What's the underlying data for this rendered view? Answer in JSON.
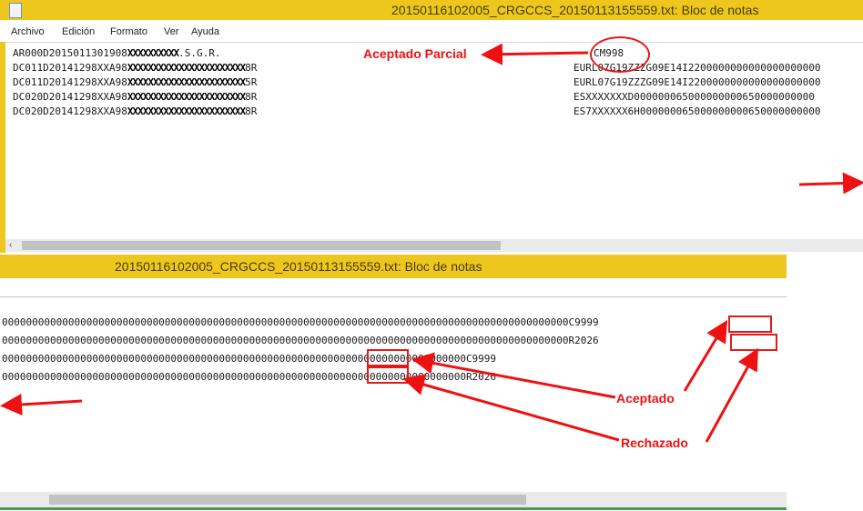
{
  "top_window": {
    "title": "20150116102005_CRGCCS_20150113155559.txt: Bloc de notas",
    "menu": [
      "Archivo",
      "Edición",
      "Formato",
      "Ver",
      "Ayuda"
    ],
    "lines": [
      {
        "prefix": "AR000D2015011301908",
        "redacted": "XXXXXXXXXX",
        "tail": ".S.G.R."
      },
      {
        "prefix": "DC011D20141298XXA98",
        "redacted": "XXXXXXXXXXXXXXXXXXXXXXX",
        "tail": "8R"
      },
      {
        "prefix": "DC011D20141298XXA98",
        "redacted": "XXXXXXXXXXXXXXXXXXXXXXX",
        "tail": "5R"
      },
      {
        "prefix": "DC020D20141298XXA98",
        "redacted": "XXXXXXXXXXXXXXXXXXXXXXX",
        "tail": "8R"
      },
      {
        "prefix": "DC020D20141298XXA98",
        "redacted": "XXXXXXXXXXXXXXXXXXXXXXX",
        "tail": "8R"
      }
    ],
    "right_lines": [
      "CM998",
      "EURL07G19ZZZG09E14I2200000000000000000000",
      "EURL07G19ZZZG09E14I2200000000000000000000",
      "ESXXXXXXXD000000065000000000650000000000",
      "ES7XXXXXX6H000000065000000000650000000000"
    ]
  },
  "bottom_window": {
    "title": "20150116102005_CRGCCS_20150113155559.txt: Bloc de notas",
    "lines": [
      {
        "zeros": "0000000000000000000000000000000000000000000000000000000000000000000000000000000000000000000000",
        "code": "C9999"
      },
      {
        "zeros": "0000000000000000000000000000000000000000000000000000000000000000000000000000000000000000000000",
        "code": "R2026"
      },
      {
        "zeros": "00000000000000000000000000000000000000000000000000000000000000000000000000000",
        "code": "C9999"
      },
      {
        "zeros": "00000000000000000000000000000000000000000000000000000000000000000000000000000",
        "code": "R2026"
      }
    ]
  },
  "annotations": {
    "aceptado_parcial": "Aceptado Parcial",
    "aceptado": "Aceptado",
    "rechazado": "Rechazado"
  },
  "colors": {
    "titlebar": "#edc71e",
    "annotation": "#ee1111"
  }
}
